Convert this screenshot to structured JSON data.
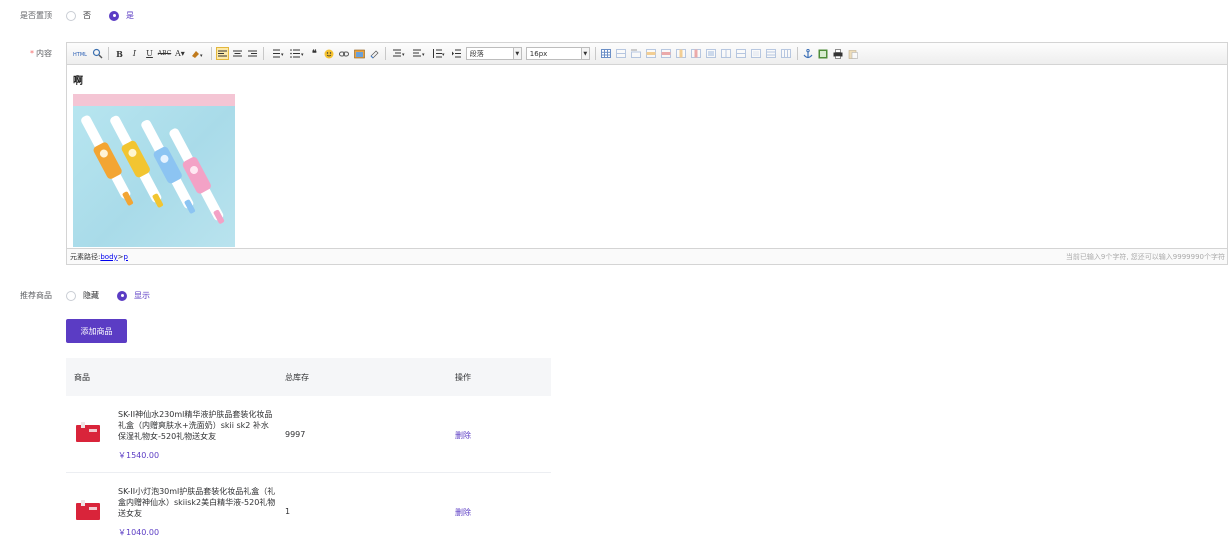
{
  "pin_top": {
    "label": "是否置顶",
    "options": [
      {
        "label": "否",
        "selected": false
      },
      {
        "label": "是",
        "selected": true
      }
    ]
  },
  "content": {
    "label": "内容",
    "required_mark": "*",
    "toolbar": {
      "paragraph_select": "段落",
      "font_size_select": "16px"
    },
    "body_text": "啊",
    "statusbar": {
      "path_label": "元素路径: ",
      "path_body": "body",
      "path_sep": " > ",
      "path_p": "p",
      "char_count": "当前已输入9个字符, 您还可以输入9999990个字符"
    }
  },
  "recommend": {
    "label": "推荐商品",
    "options": [
      {
        "label": "隐藏",
        "selected": false
      },
      {
        "label": "显示",
        "selected": true
      }
    ]
  },
  "add_button": "添加商品",
  "table": {
    "headers": {
      "product": "商品",
      "stock": "总库存",
      "action": "操作"
    },
    "rows": [
      {
        "name": "SK-II神仙水230ml精华液护肤品套装化妆品礼盒（内赠爽肤水+洗面奶）skii sk2 补水保湿礼物女-520礼物送女友",
        "price": "￥1540.00",
        "stock": "9997",
        "action": "删除"
      },
      {
        "name": "SK-II小灯泡30ml护肤品套装化妆品礼盒（礼盒内赠神仙水）skiisk2美白精华液-520礼物送女友",
        "price": "￥1040.00",
        "stock": "1",
        "action": "删除"
      }
    ]
  },
  "colors": {
    "accent": "#5b3cc4",
    "required": "#f56c6c"
  }
}
